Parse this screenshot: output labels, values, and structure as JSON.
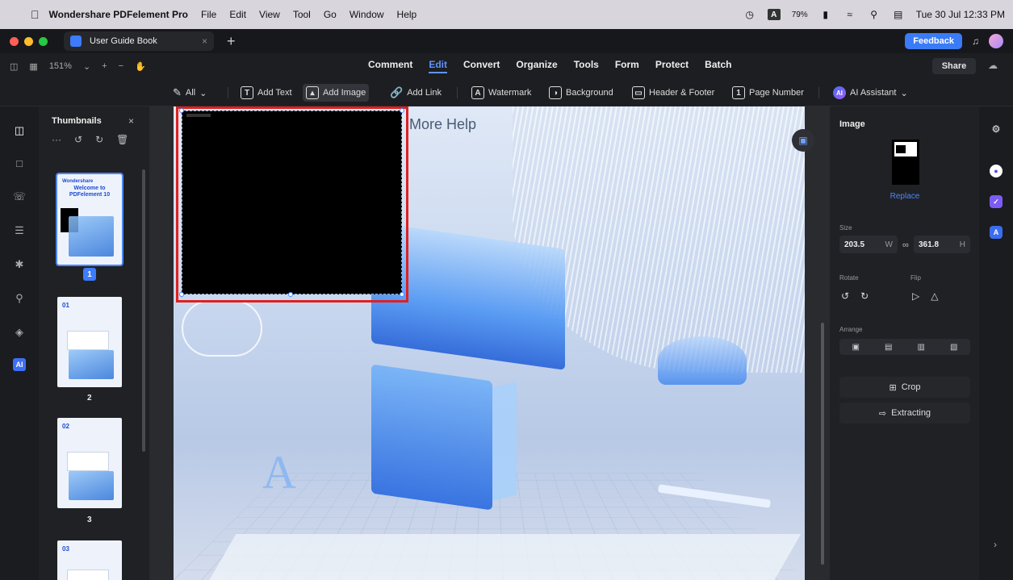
{
  "menubar": {
    "apple": "",
    "app_name": "Wondershare PDFelement Pro",
    "menus": [
      "File",
      "Edit",
      "View",
      "Tool",
      "Go",
      "Window",
      "Help"
    ],
    "input_badge": "A",
    "battery": "79%",
    "datetime": "Tue 30 Jul  12:33 PM"
  },
  "tabbar": {
    "tab_label": "User Guide Book",
    "tab_close": "×",
    "new_tab": "+",
    "feedback": "Feedback"
  },
  "mainrow": {
    "zoom": "151%",
    "zoom_in": "+",
    "zoom_out": "−",
    "menus": [
      "Comment",
      "Edit",
      "Convert",
      "Organize",
      "Tools",
      "Form",
      "Protect",
      "Batch"
    ],
    "active_menu": "Edit",
    "share": "Share"
  },
  "edit_toolbar": {
    "all": "All",
    "add_text": "Add Text",
    "add_image": "Add Image",
    "add_link": "Add Link",
    "watermark": "Watermark",
    "background": "Background",
    "header_footer": "Header & Footer",
    "page_number": "Page Number",
    "ai_assistant": "AI Assistant",
    "ai_icon": "AI"
  },
  "rail": {
    "ai_label": "AI"
  },
  "thumbnails": {
    "title": "Thumbnails",
    "close": "×",
    "more": "···",
    "pages": [
      {
        "num": "1",
        "hdr": "Wondershare",
        "text": "Welcome to PDFelement 10"
      },
      {
        "num": "2",
        "hdr": "01",
        "text": ""
      },
      {
        "num": "3",
        "hdr": "02",
        "text": ""
      },
      {
        "num": "",
        "hdr": "03",
        "text": ""
      }
    ]
  },
  "canvas": {
    "heading_text": "More Help",
    "letter": "A"
  },
  "properties": {
    "title": "Image",
    "replace": "Replace",
    "size_label": "Size",
    "width": "203.5",
    "width_unit": "W",
    "height": "361.8",
    "height_unit": "H",
    "rotate_label": "Rotate",
    "flip_label": "Flip",
    "arrange_label": "Arrange",
    "crop": "Crop",
    "extracting": "Extracting"
  },
  "colors": {
    "accent": "#3a7bf7",
    "selection": "#e02020",
    "panel": "#202124"
  }
}
